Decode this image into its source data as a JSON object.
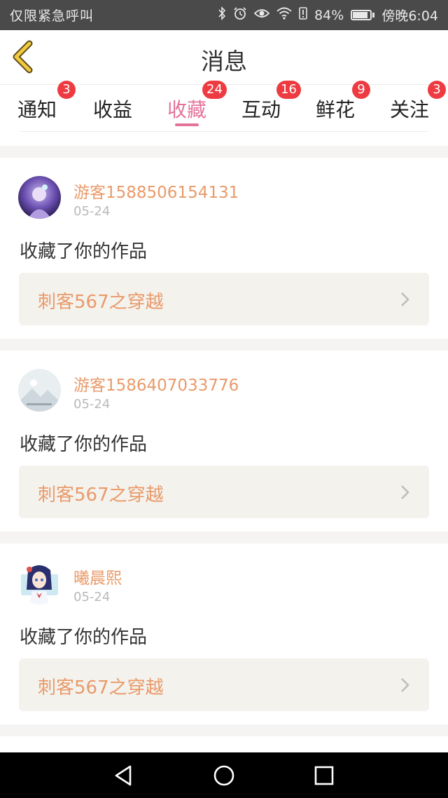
{
  "status_bar": {
    "carrier": "仅限紧急呼叫",
    "battery": "84%",
    "time": "傍晚6:04"
  },
  "header": {
    "title": "消息"
  },
  "tabs": [
    {
      "label": "通知",
      "badge": "3"
    },
    {
      "label": "收益",
      "badge": ""
    },
    {
      "label": "收藏",
      "badge": "24",
      "active": true
    },
    {
      "label": "互动",
      "badge": "16"
    },
    {
      "label": "鲜花",
      "badge": "9"
    },
    {
      "label": "关注",
      "badge": "3"
    }
  ],
  "items": [
    {
      "user": "游客1588506154131",
      "date": "05-24",
      "action": "收藏了你的作品",
      "work": "刺客567之穿越"
    },
    {
      "user": "游客1586407033776",
      "date": "05-24",
      "action": "收藏了你的作品",
      "work": "刺客567之穿越"
    },
    {
      "user": "曦晨熙",
      "date": "05-24",
      "action": "收藏了你的作品",
      "work": "刺客567之穿越"
    }
  ],
  "colors": {
    "accent": "#e4739b",
    "username": "#e99a6a",
    "badge": "#ee3b42"
  }
}
